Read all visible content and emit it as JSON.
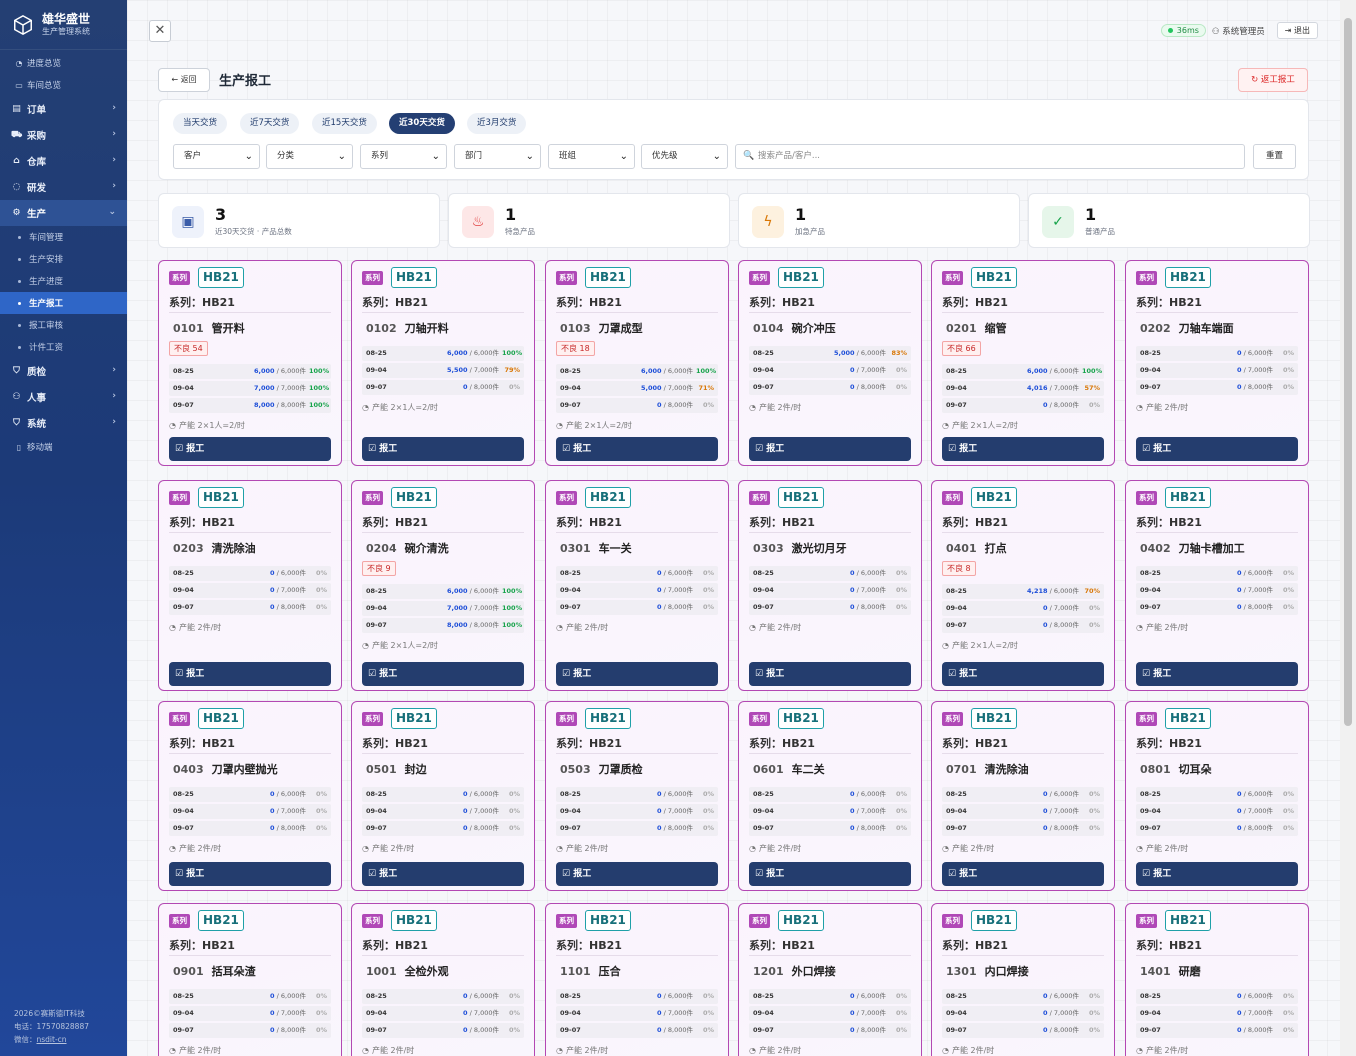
{
  "brand": {
    "name": "雄华盛世",
    "subtitle": "生产管理系统"
  },
  "nav": {
    "top_items": [
      {
        "label": "进度总览",
        "icon": "gauge-icon"
      },
      {
        "label": "车间总览",
        "icon": "monitor-icon"
      }
    ],
    "groups": [
      {
        "label": "订单",
        "icon": "order-icon"
      },
      {
        "label": "采购",
        "icon": "cart-icon"
      },
      {
        "label": "仓库",
        "icon": "warehouse-icon"
      },
      {
        "label": "研发",
        "icon": "bulb-icon"
      },
      {
        "label": "生产",
        "icon": "gear-icon",
        "expanded": true,
        "children": [
          "车间管理",
          "生产安排",
          "生产进度",
          "生产报工",
          "报工审核",
          "计件工资"
        ],
        "active_child": "生产报工"
      },
      {
        "label": "质检",
        "icon": "shield-check-icon"
      },
      {
        "label": "人事",
        "icon": "people-icon"
      },
      {
        "label": "系统",
        "icon": "shield-icon"
      }
    ],
    "mobile": {
      "label": "移动端",
      "icon": "phone-icon"
    }
  },
  "footer": {
    "copyright": "2026©赛斯德IT科技",
    "phone": "电话：17570828887",
    "wechat_label": "微信：",
    "wechat": "nsdit-cn"
  },
  "topbar": {
    "ping": "36ms",
    "user": "系统管理员",
    "logout": "退出"
  },
  "header": {
    "back": "← 返回",
    "title": "生产报工",
    "report_btn": "返工报工"
  },
  "filters": {
    "chips": [
      {
        "label": "当天交货"
      },
      {
        "label": "近7天交货"
      },
      {
        "label": "近15天交货"
      },
      {
        "label": "近30天交货",
        "active": true
      },
      {
        "label": "近3月交货"
      }
    ],
    "selects": [
      "客户",
      "分类",
      "系列",
      "部门",
      "班组",
      "优先级"
    ],
    "search_placeholder": "搜索产品/客户...",
    "reset": "重置"
  },
  "stats": [
    {
      "num": "3",
      "label": "近30天交货 · 产品总数",
      "icon": "box-icon",
      "bg": "#eef2fb",
      "color": "#3b5da8",
      "glyph": "▣"
    },
    {
      "num": "1",
      "label": "特急产品",
      "icon": "fire-icon",
      "bg": "#fde7e7",
      "color": "#dc2626",
      "glyph": "♨"
    },
    {
      "num": "1",
      "label": "加急产品",
      "icon": "bolt-icon",
      "bg": "#fdf1df",
      "color": "#d97706",
      "glyph": "ϟ"
    },
    {
      "num": "1",
      "label": "普通产品",
      "icon": "check-circle-icon",
      "bg": "#e6f6ea",
      "color": "#16a34a",
      "glyph": "✓"
    }
  ],
  "card_common": {
    "badge": "系列",
    "code": "HB21",
    "series": "系列：HB21",
    "button": "报工"
  },
  "cards": [
    {
      "no": "0101",
      "name": "管开料",
      "defect": "不良 54",
      "rows": [
        [
          "08-25",
          "6,000",
          "6,000件",
          "100%"
        ],
        [
          "09-04",
          "7,000",
          "7,000件",
          "100%"
        ],
        [
          "09-07",
          "8,000",
          "8,000件",
          "100%"
        ]
      ],
      "cap": "产能 2×1人=2/时"
    },
    {
      "no": "0102",
      "name": "刀轴开料",
      "defect": "",
      "rows": [
        [
          "08-25",
          "6,000",
          "6,000件",
          "100%"
        ],
        [
          "09-04",
          "5,500",
          "7,000件",
          "79%"
        ],
        [
          "09-07",
          "0",
          "8,000件",
          "0%"
        ]
      ],
      "cap": "产能 2×1人=2/时"
    },
    {
      "no": "0103",
      "name": "刀罩成型",
      "defect": "不良 18",
      "rows": [
        [
          "08-25",
          "6,000",
          "6,000件",
          "100%"
        ],
        [
          "09-04",
          "5,000",
          "7,000件",
          "71%"
        ],
        [
          "09-07",
          "0",
          "8,000件",
          "0%"
        ]
      ],
      "cap": "产能 2×1人=2/时"
    },
    {
      "no": "0104",
      "name": "碗介冲压",
      "defect": "",
      "rows": [
        [
          "08-25",
          "5,000",
          "6,000件",
          "83%"
        ],
        [
          "09-04",
          "0",
          "7,000件",
          "0%"
        ],
        [
          "09-07",
          "0",
          "8,000件",
          "0%"
        ]
      ],
      "cap": "产能 2件/时"
    },
    {
      "no": "0201",
      "name": "缩管",
      "defect": "不良 66",
      "rows": [
        [
          "08-25",
          "6,000",
          "6,000件",
          "100%"
        ],
        [
          "09-04",
          "4,016",
          "7,000件",
          "57%"
        ],
        [
          "09-07",
          "0",
          "8,000件",
          "0%"
        ]
      ],
      "cap": "产能 2×1人=2/时"
    },
    {
      "no": "0202",
      "name": "刀轴车端面",
      "defect": "",
      "rows": [
        [
          "08-25",
          "0",
          "6,000件",
          "0%"
        ],
        [
          "09-04",
          "0",
          "7,000件",
          "0%"
        ],
        [
          "09-07",
          "0",
          "8,000件",
          "0%"
        ]
      ],
      "cap": "产能 2件/时"
    },
    {
      "no": "0203",
      "name": "清洗除油",
      "defect": "",
      "rows": [
        [
          "08-25",
          "0",
          "6,000件",
          "0%"
        ],
        [
          "09-04",
          "0",
          "7,000件",
          "0%"
        ],
        [
          "09-07",
          "0",
          "8,000件",
          "0%"
        ]
      ],
      "cap": "产能 2件/时"
    },
    {
      "no": "0204",
      "name": "碗介清洗",
      "defect": "不良 9",
      "rows": [
        [
          "08-25",
          "6,000",
          "6,000件",
          "100%"
        ],
        [
          "09-04",
          "7,000",
          "7,000件",
          "100%"
        ],
        [
          "09-07",
          "8,000",
          "8,000件",
          "100%"
        ]
      ],
      "cap": "产能 2×1人=2/时"
    },
    {
      "no": "0301",
      "name": "车一关",
      "defect": "",
      "rows": [
        [
          "08-25",
          "0",
          "6,000件",
          "0%"
        ],
        [
          "09-04",
          "0",
          "7,000件",
          "0%"
        ],
        [
          "09-07",
          "0",
          "8,000件",
          "0%"
        ]
      ],
      "cap": "产能 2件/时"
    },
    {
      "no": "0303",
      "name": "激光切月牙",
      "defect": "",
      "rows": [
        [
          "08-25",
          "0",
          "6,000件",
          "0%"
        ],
        [
          "09-04",
          "0",
          "7,000件",
          "0%"
        ],
        [
          "09-07",
          "0",
          "8,000件",
          "0%"
        ]
      ],
      "cap": "产能 2件/时"
    },
    {
      "no": "0401",
      "name": "打点",
      "defect": "不良 8",
      "rows": [
        [
          "08-25",
          "4,218",
          "6,000件",
          "70%"
        ],
        [
          "09-04",
          "0",
          "7,000件",
          "0%"
        ],
        [
          "09-07",
          "0",
          "8,000件",
          "0%"
        ]
      ],
      "cap": "产能 2×1人=2/时"
    },
    {
      "no": "0402",
      "name": "刀轴卡槽加工",
      "defect": "",
      "rows": [
        [
          "08-25",
          "0",
          "6,000件",
          "0%"
        ],
        [
          "09-04",
          "0",
          "7,000件",
          "0%"
        ],
        [
          "09-07",
          "0",
          "8,000件",
          "0%"
        ]
      ],
      "cap": "产能 2件/时"
    },
    {
      "no": "0403",
      "name": "刀罩内壁抛光",
      "defect": "",
      "rows": [
        [
          "08-25",
          "0",
          "6,000件",
          "0%"
        ],
        [
          "09-04",
          "0",
          "7,000件",
          "0%"
        ],
        [
          "09-07",
          "0",
          "8,000件",
          "0%"
        ]
      ],
      "cap": "产能 2件/时"
    },
    {
      "no": "0501",
      "name": "封边",
      "defect": "",
      "rows": [
        [
          "08-25",
          "0",
          "6,000件",
          "0%"
        ],
        [
          "09-04",
          "0",
          "7,000件",
          "0%"
        ],
        [
          "09-07",
          "0",
          "8,000件",
          "0%"
        ]
      ],
      "cap": "产能 2件/时"
    },
    {
      "no": "0503",
      "name": "刀罩质检",
      "defect": "",
      "rows": [
        [
          "08-25",
          "0",
          "6,000件",
          "0%"
        ],
        [
          "09-04",
          "0",
          "7,000件",
          "0%"
        ],
        [
          "09-07",
          "0",
          "8,000件",
          "0%"
        ]
      ],
      "cap": "产能 2件/时"
    },
    {
      "no": "0601",
      "name": "车二关",
      "defect": "",
      "rows": [
        [
          "08-25",
          "0",
          "6,000件",
          "0%"
        ],
        [
          "09-04",
          "0",
          "7,000件",
          "0%"
        ],
        [
          "09-07",
          "0",
          "8,000件",
          "0%"
        ]
      ],
      "cap": "产能 2件/时"
    },
    {
      "no": "0701",
      "name": "清洗除油",
      "defect": "",
      "rows": [
        [
          "08-25",
          "0",
          "6,000件",
          "0%"
        ],
        [
          "09-04",
          "0",
          "7,000件",
          "0%"
        ],
        [
          "09-07",
          "0",
          "8,000件",
          "0%"
        ]
      ],
      "cap": "产能 2件/时"
    },
    {
      "no": "0801",
      "name": "切耳朵",
      "defect": "",
      "rows": [
        [
          "08-25",
          "0",
          "6,000件",
          "0%"
        ],
        [
          "09-04",
          "0",
          "7,000件",
          "0%"
        ],
        [
          "09-07",
          "0",
          "8,000件",
          "0%"
        ]
      ],
      "cap": "产能 2件/时"
    },
    {
      "no": "0901",
      "name": "括耳朵渣",
      "defect": "",
      "rows": [
        [
          "08-25",
          "0",
          "6,000件",
          "0%"
        ],
        [
          "09-04",
          "0",
          "7,000件",
          "0%"
        ],
        [
          "09-07",
          "0",
          "8,000件",
          "0%"
        ]
      ],
      "cap": "产能 2件/时"
    },
    {
      "no": "1001",
      "name": "全检外观",
      "defect": "",
      "rows": [
        [
          "08-25",
          "0",
          "6,000件",
          "0%"
        ],
        [
          "09-04",
          "0",
          "7,000件",
          "0%"
        ],
        [
          "09-07",
          "0",
          "8,000件",
          "0%"
        ]
      ],
      "cap": "产能 2件/时"
    },
    {
      "no": "1101",
      "name": "压合",
      "defect": "",
      "rows": [
        [
          "08-25",
          "0",
          "6,000件",
          "0%"
        ],
        [
          "09-04",
          "0",
          "7,000件",
          "0%"
        ],
        [
          "09-07",
          "0",
          "8,000件",
          "0%"
        ]
      ],
      "cap": "产能 2件/时"
    },
    {
      "no": "1201",
      "name": "外口焊接",
      "defect": "",
      "rows": [
        [
          "08-25",
          "0",
          "6,000件",
          "0%"
        ],
        [
          "09-04",
          "0",
          "7,000件",
          "0%"
        ],
        [
          "09-07",
          "0",
          "8,000件",
          "0%"
        ]
      ],
      "cap": "产能 2件/时"
    },
    {
      "no": "1301",
      "name": "内口焊接",
      "defect": "",
      "rows": [
        [
          "08-25",
          "0",
          "6,000件",
          "0%"
        ],
        [
          "09-04",
          "0",
          "7,000件",
          "0%"
        ],
        [
          "09-07",
          "0",
          "8,000件",
          "0%"
        ]
      ],
      "cap": "产能 2件/时"
    },
    {
      "no": "1401",
      "name": "研磨",
      "defect": "",
      "rows": [
        [
          "08-25",
          "0",
          "6,000件",
          "0%"
        ],
        [
          "09-04",
          "0",
          "7,000件",
          "0%"
        ],
        [
          "09-07",
          "0",
          "8,000件",
          "0%"
        ]
      ],
      "cap": "产能 2件/时"
    }
  ]
}
